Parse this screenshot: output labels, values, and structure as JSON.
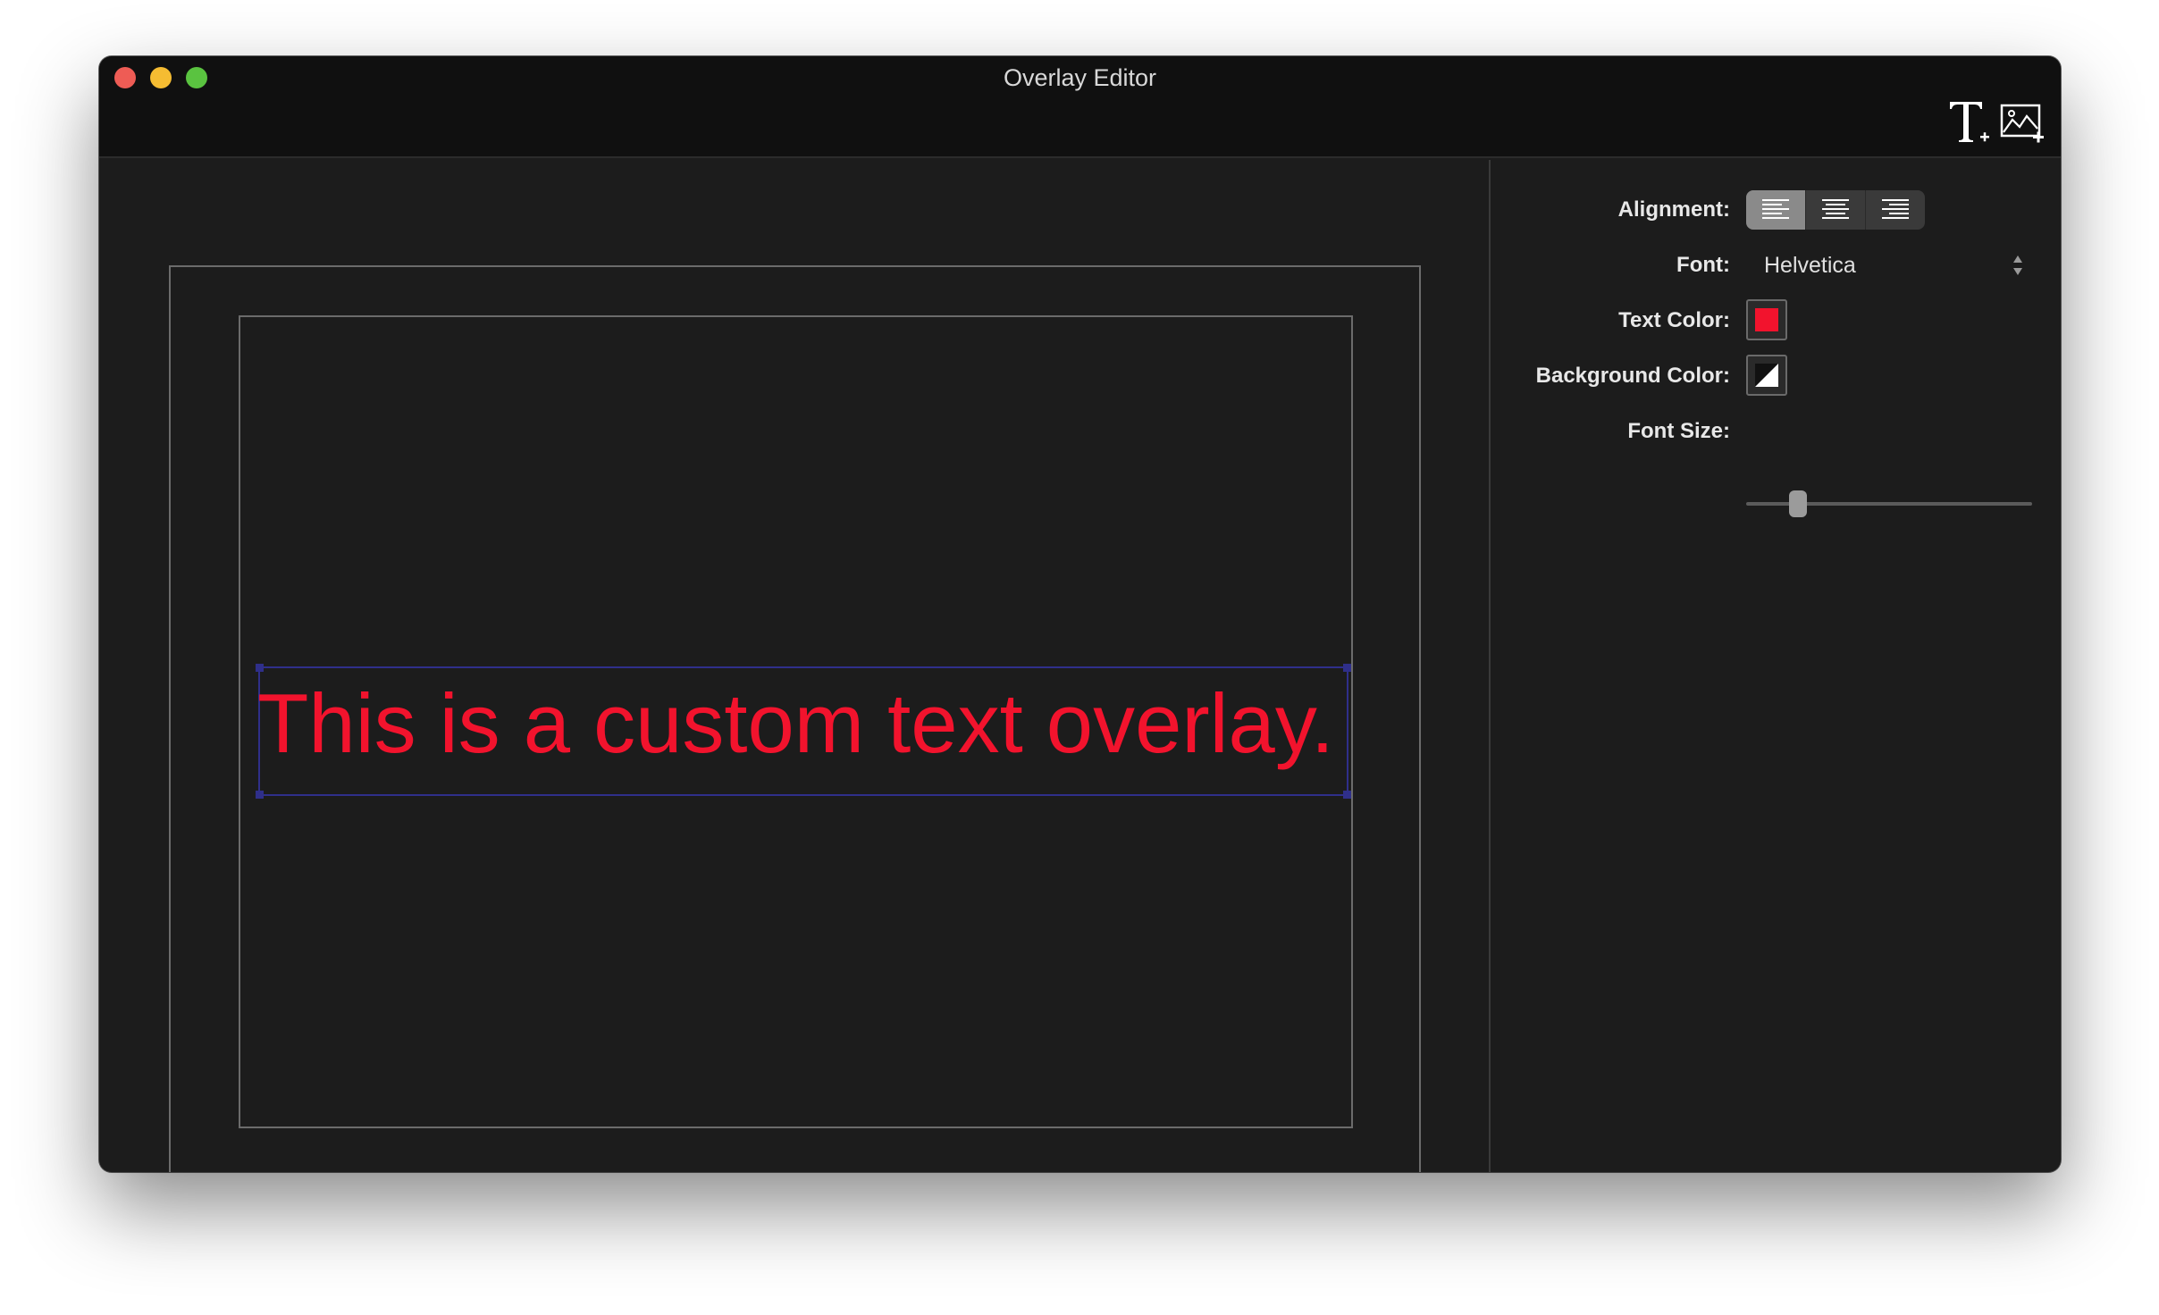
{
  "window": {
    "title": "Overlay Editor"
  },
  "toolbar": {
    "add_text_icon": "text-plus-icon",
    "add_image_icon": "image-plus-icon"
  },
  "canvas": {
    "overlay_text": "This is a custom text overlay.",
    "overlay_text_color": "#f2132d",
    "selection_color": "#2f2f8a"
  },
  "inspector": {
    "alignment_label": "Alignment:",
    "alignment_options": [
      "left",
      "center",
      "right"
    ],
    "alignment_selected": "left",
    "font_label": "Font:",
    "font_value": "Helvetica",
    "text_color_label": "Text  Color:",
    "text_color": "#f2132d",
    "background_color_label": "Background Color:",
    "background_color": "none",
    "font_size_label": "Font Size:",
    "font_size_fraction": 0.18
  }
}
